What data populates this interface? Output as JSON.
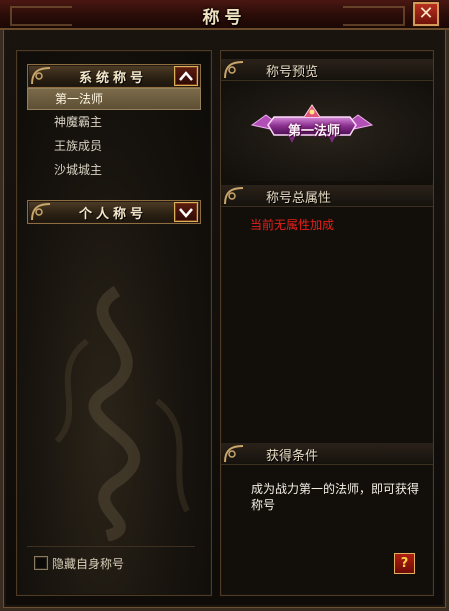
{
  "window": {
    "title": "称号",
    "close_symbol": "✕"
  },
  "categories": [
    {
      "label": "系统称号",
      "arrow": "up"
    },
    {
      "label": "个人称号",
      "arrow": "down"
    }
  ],
  "system_titles": [
    {
      "label": "第一法师",
      "selected": true
    },
    {
      "label": "神魔霸主",
      "selected": false
    },
    {
      "label": "王族成员",
      "selected": false
    },
    {
      "label": "沙城城主",
      "selected": false
    }
  ],
  "preview": {
    "header": "称号预览",
    "badge_text": "第一法师"
  },
  "attributes": {
    "header": "称号总属性",
    "text": "当前无属性加成",
    "text_color": "#e2201a"
  },
  "conditions": {
    "header": "获得条件",
    "text": "成为战力第一的法师，即可获得称号"
  },
  "footer": {
    "hide_label": "隐藏自身称号",
    "hide_checked": false,
    "help_symbol": "?"
  }
}
